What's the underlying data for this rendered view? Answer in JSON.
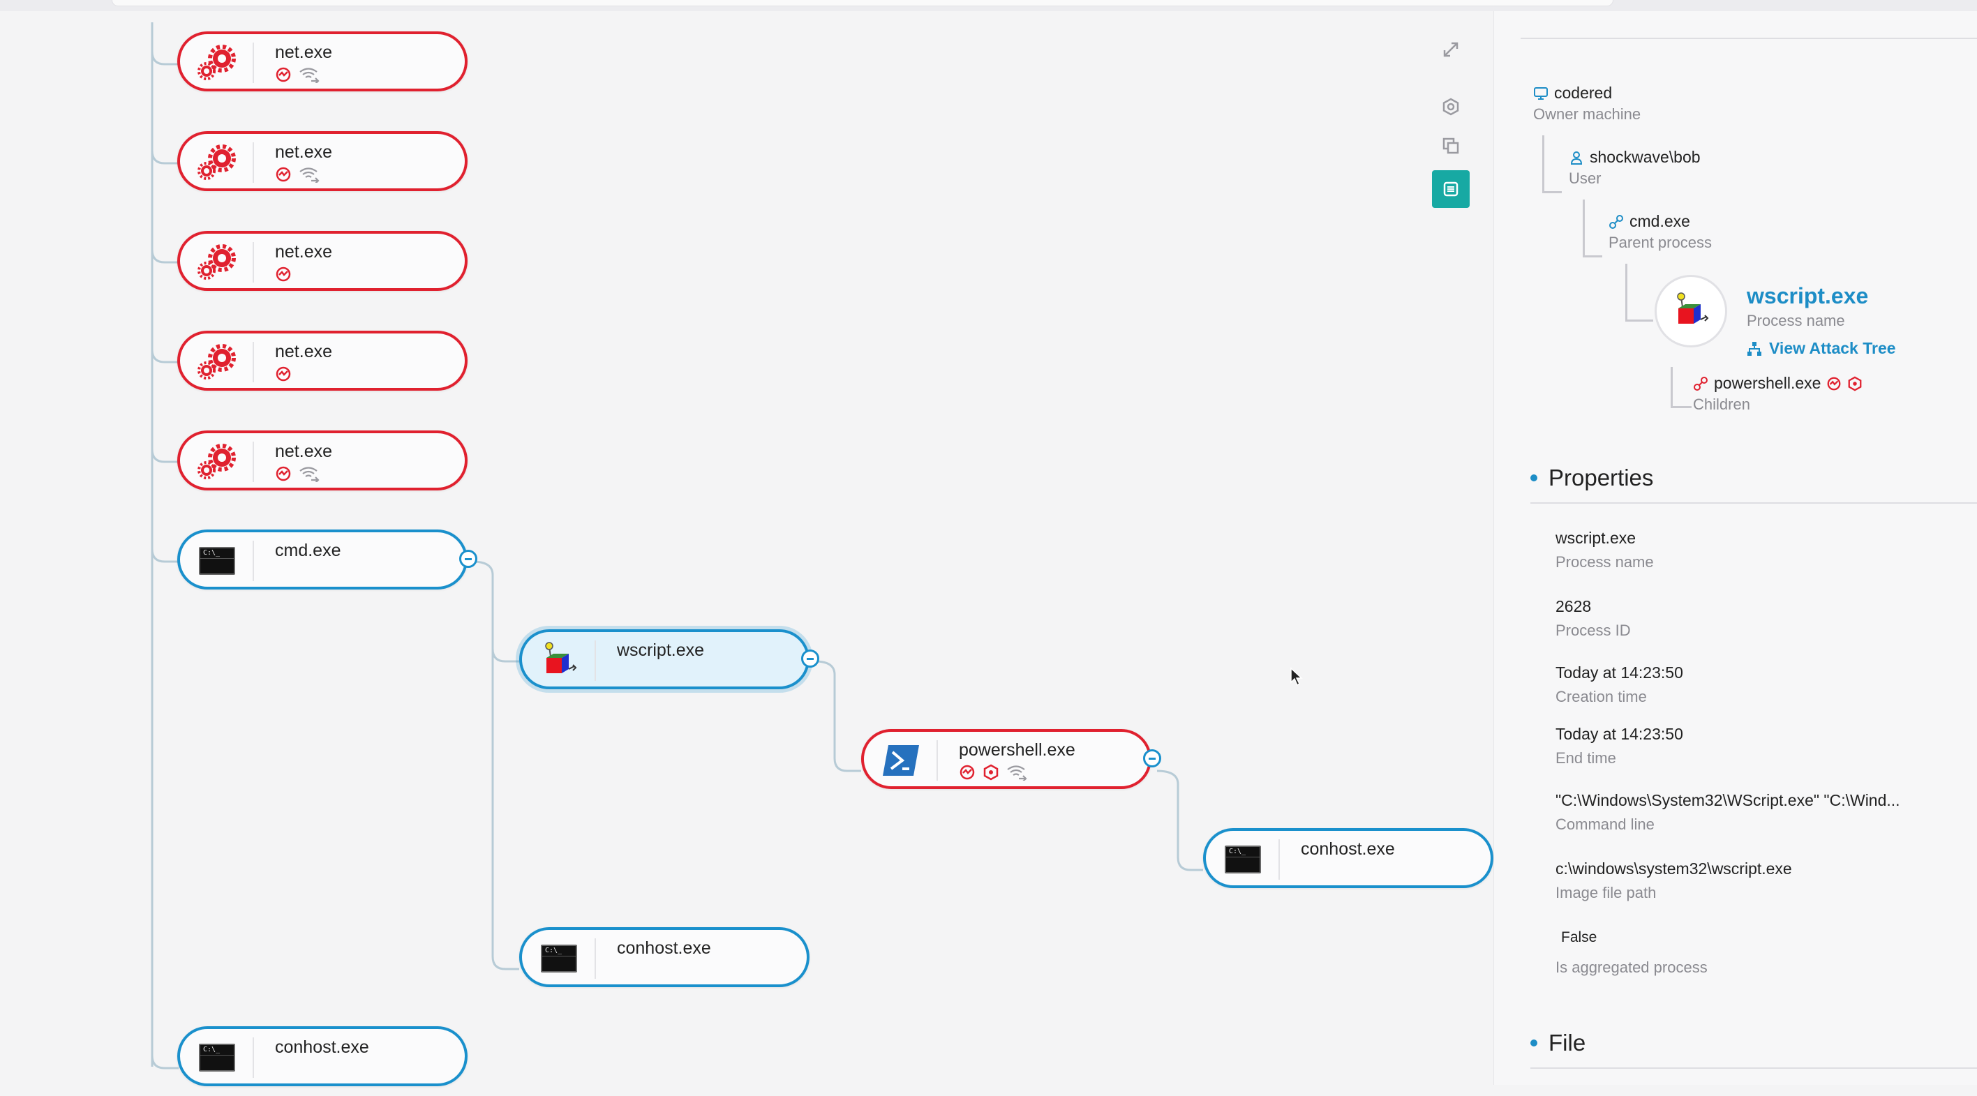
{
  "graph": {
    "nodes": [
      {
        "label": "net.exe",
        "type": "gear"
      },
      {
        "label": "net.exe",
        "type": "gear"
      },
      {
        "label": "net.exe",
        "type": "gear"
      },
      {
        "label": "net.exe",
        "type": "gear"
      },
      {
        "label": "net.exe",
        "type": "gear"
      },
      {
        "label": "cmd.exe",
        "type": "cmd"
      },
      {
        "label": "wscript.exe",
        "type": "wscript"
      },
      {
        "label": "powershell.exe",
        "type": "powershell"
      },
      {
        "label": "conhost.exe",
        "type": "cmd"
      },
      {
        "label": "conhost.exe",
        "type": "cmd"
      },
      {
        "label": "conhost.exe",
        "type": "cmd"
      }
    ]
  },
  "toolbar": {
    "tools": [
      "expand-icon",
      "settings-hex-icon",
      "copy-icon",
      "list-icon"
    ]
  },
  "panel": {
    "tree": {
      "machine": {
        "value": "codered",
        "key": "Owner machine"
      },
      "user": {
        "value": "shockwave\\bob",
        "key": "User"
      },
      "parent": {
        "value": "cmd.exe",
        "key": "Parent process"
      },
      "process": {
        "value": "wscript.exe",
        "key": "Process name"
      },
      "view_attack_tree": "View Attack Tree",
      "children": {
        "value": "powershell.exe",
        "key": "Children"
      }
    },
    "properties_title": "Properties",
    "properties": [
      {
        "value": "wscript.exe",
        "key": "Process name"
      },
      {
        "value": "2628",
        "key": "Process ID"
      },
      {
        "value": "Today at 14:23:50",
        "key": "Creation time"
      },
      {
        "value": "Today at 14:23:50",
        "key": "End time"
      },
      {
        "value": "\"C:\\Windows\\System32\\WScript.exe\" \"C:\\Wind...",
        "key": "Command line"
      },
      {
        "value": "c:\\windows\\system32\\wscript.exe",
        "key": "Image file path"
      },
      {
        "value": "False",
        "key": "Is aggregated process"
      }
    ],
    "file_title": "File"
  },
  "colors": {
    "alert_red": "#e0212f",
    "info_blue": "#1a90cc",
    "accent_teal": "#17a9a3"
  }
}
